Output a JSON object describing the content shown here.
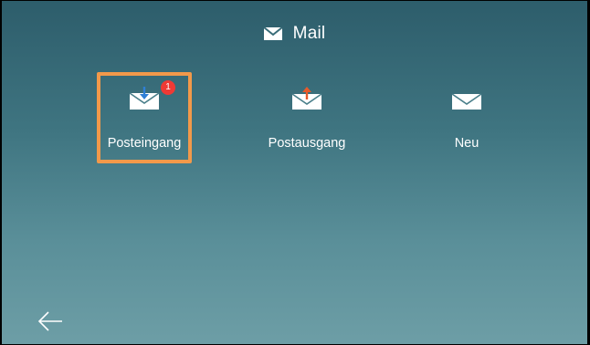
{
  "header": {
    "title": "Mail",
    "icon": "envelope-icon"
  },
  "apps": [
    {
      "label": "Posteingang",
      "icon": "inbox-icon",
      "badge": "1",
      "selected": true
    },
    {
      "label": "Postausgang",
      "icon": "outbox-icon",
      "selected": false
    },
    {
      "label": "Neu",
      "icon": "new-mail-icon",
      "selected": false
    }
  ],
  "footer": {
    "back_icon": "back-arrow-icon"
  },
  "colors": {
    "selection": "#f2994a",
    "badge": "#ef3a35",
    "inbox_arrow": "#2f7fd6",
    "outbox_arrow": "#e85a2a"
  }
}
